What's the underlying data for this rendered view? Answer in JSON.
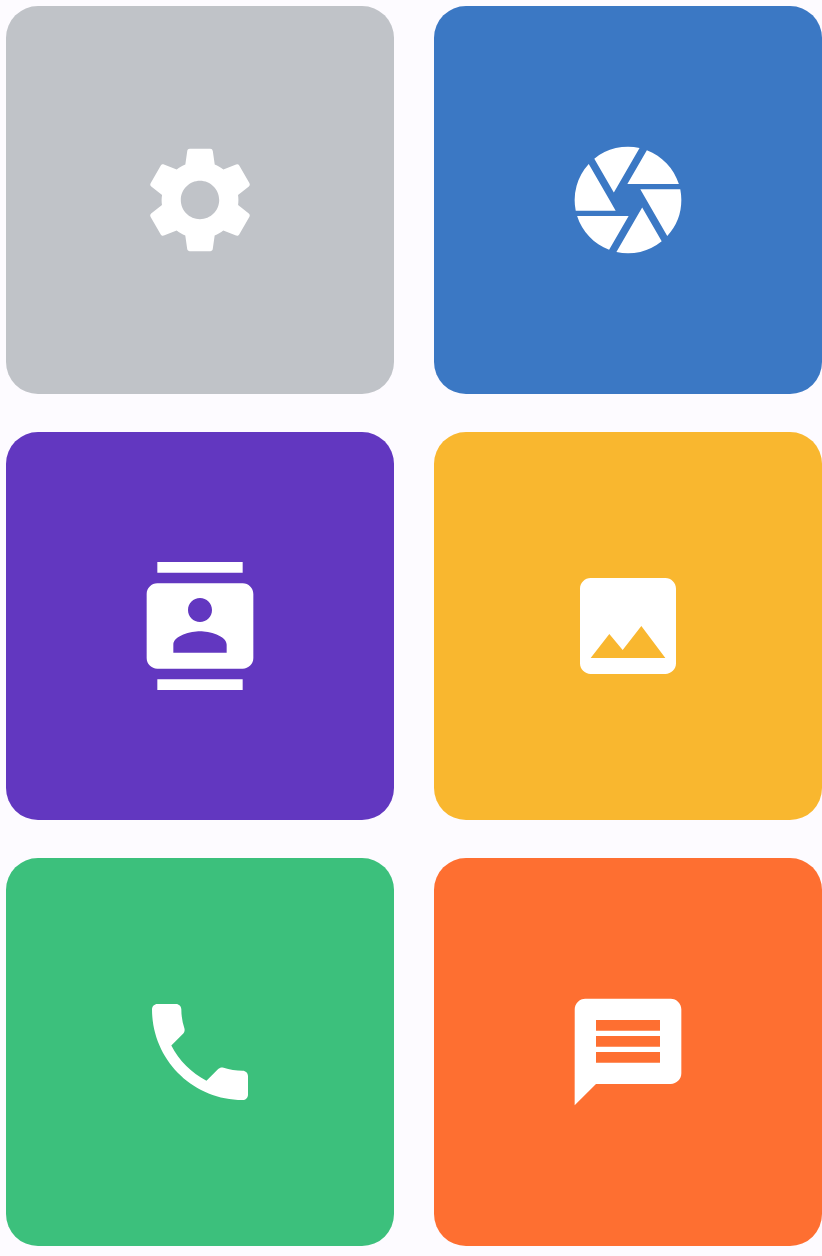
{
  "tiles": [
    {
      "kind": "settings",
      "color": "#c0c3c8"
    },
    {
      "kind": "camera",
      "color": "#3b78c4"
    },
    {
      "kind": "contacts",
      "color": "#6237c0"
    },
    {
      "kind": "gallery",
      "color": "#f9b72f"
    },
    {
      "kind": "phone",
      "color": "#3cc07c"
    },
    {
      "kind": "messages",
      "color": "#fe6f31"
    }
  ]
}
